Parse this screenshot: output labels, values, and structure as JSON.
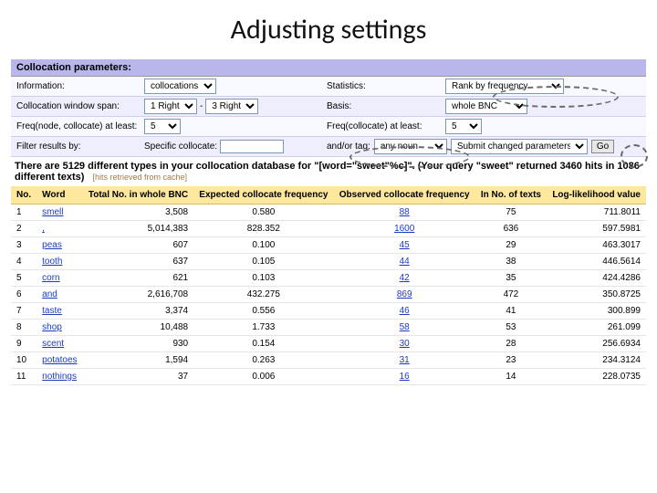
{
  "title": "Adjusting settings",
  "panel": {
    "heading": "Collocation parameters:"
  },
  "rows": {
    "info_label": "Information:",
    "info_value": "collocations",
    "stats_label": "Statistics:",
    "stats_value": "Rank by frequency",
    "span_label": "Collocation window span:",
    "span_left": "1 Right",
    "span_dash": "-",
    "span_right": "3 Right",
    "basis_label": "Basis:",
    "basis_value": "whole BNC",
    "freq_nc_label": "Freq(node, collocate) at least:",
    "freq_nc_value": "5",
    "freq_c_label": "Freq(collocate) at least:",
    "freq_c_value": "5",
    "filter_label": "Filter results by:",
    "specific_label": "Specific collocate:",
    "specific_value": "",
    "andor_label": "and/or tag:",
    "andor_value": "any noun",
    "submit_label": "Submit changed parameters",
    "go_label": "Go"
  },
  "summary_text": "There are 5129 different types in your collocation database for \"[word=\"sweet\"%c]\". (Your query \"sweet\" returned 3460 hits in 1086 different texts)",
  "note_text": "[hits retrieved from cache]",
  "table": {
    "headers": {
      "no": "No.",
      "word": "Word",
      "total": "Total No. in whole BNC",
      "expected": "Expected collocate frequency",
      "observed": "Observed collocate frequency",
      "texts": "In No. of texts",
      "ll": "Log-likelihood value"
    },
    "rows": [
      {
        "no": "1",
        "word": "smell",
        "total": "3,508",
        "expected": "0.580",
        "observed": "88",
        "texts": "75",
        "ll": "711.8011"
      },
      {
        "no": "2",
        "word": ",",
        "total": "5,014,383",
        "expected": "828.352",
        "observed": "1600",
        "texts": "636",
        "ll": "597.5981"
      },
      {
        "no": "3",
        "word": "peas",
        "total": "607",
        "expected": "0.100",
        "observed": "45",
        "texts": "29",
        "ll": "463.3017"
      },
      {
        "no": "4",
        "word": "tooth",
        "total": "637",
        "expected": "0.105",
        "observed": "44",
        "texts": "38",
        "ll": "446.5614"
      },
      {
        "no": "5",
        "word": "corn",
        "total": "621",
        "expected": "0.103",
        "observed": "42",
        "texts": "35",
        "ll": "424.4286"
      },
      {
        "no": "6",
        "word": "and",
        "total": "2,616,708",
        "expected": "432.275",
        "observed": "869",
        "texts": "472",
        "ll": "350.8725"
      },
      {
        "no": "7",
        "word": "taste",
        "total": "3,374",
        "expected": "0.556",
        "observed": "46",
        "texts": "41",
        "ll": "300.899"
      },
      {
        "no": "8",
        "word": "shop",
        "total": "10,488",
        "expected": "1.733",
        "observed": "58",
        "texts": "53",
        "ll": "261.099"
      },
      {
        "no": "9",
        "word": "scent",
        "total": "930",
        "expected": "0.154",
        "observed": "30",
        "texts": "28",
        "ll": "256.6934"
      },
      {
        "no": "10",
        "word": "potatoes",
        "total": "1,594",
        "expected": "0.263",
        "observed": "31",
        "texts": "23",
        "ll": "234.3124"
      },
      {
        "no": "11",
        "word": "nothings",
        "total": "37",
        "expected": "0.006",
        "observed": "16",
        "texts": "14",
        "ll": "228.0735"
      }
    ]
  }
}
